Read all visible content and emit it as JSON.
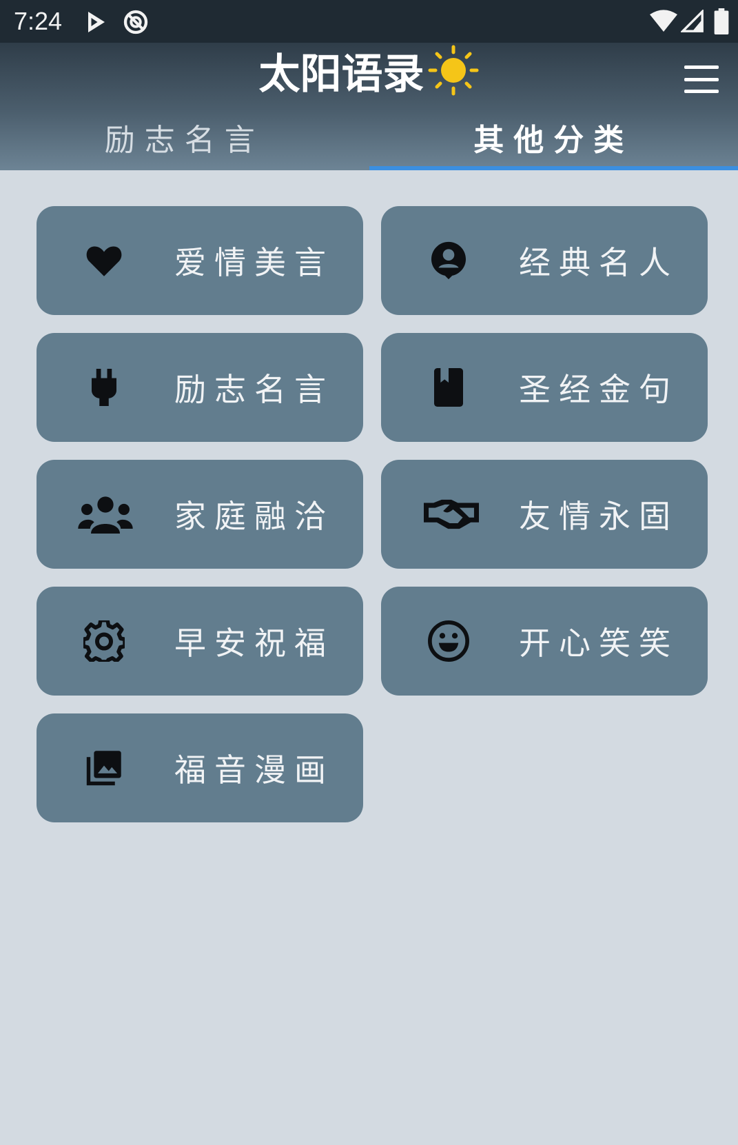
{
  "status_bar": {
    "time": "7:24",
    "icons": [
      "play-store-icon",
      "at-sign-icon",
      "wifi-icon",
      "signal-icon",
      "battery-icon"
    ]
  },
  "app": {
    "logo_text": "太阳语录",
    "logo_icon": "sun-icon",
    "menu_icon": "hamburger-menu-icon"
  },
  "tabs": [
    {
      "label": "励志名言",
      "active": false
    },
    {
      "label": "其他分类",
      "active": true
    }
  ],
  "categories": [
    {
      "label": "爱情美言",
      "icon": "heart-icon"
    },
    {
      "label": "经典名人",
      "icon": "person-pin-icon"
    },
    {
      "label": "励志名言",
      "icon": "plug-icon"
    },
    {
      "label": "圣经金句",
      "icon": "book-icon"
    },
    {
      "label": "家庭融洽",
      "icon": "group-icon"
    },
    {
      "label": "友情永固",
      "icon": "handshake-icon"
    },
    {
      "label": "早安祝福",
      "icon": "gear-icon"
    },
    {
      "label": "开心笑笑",
      "icon": "smile-icon"
    },
    {
      "label": "福音漫画",
      "icon": "photo-library-icon"
    }
  ],
  "colors": {
    "background": "#d3dae1",
    "card": "#627d8e",
    "tab_indicator": "#3b8fe0",
    "sun": "#f5c518"
  }
}
